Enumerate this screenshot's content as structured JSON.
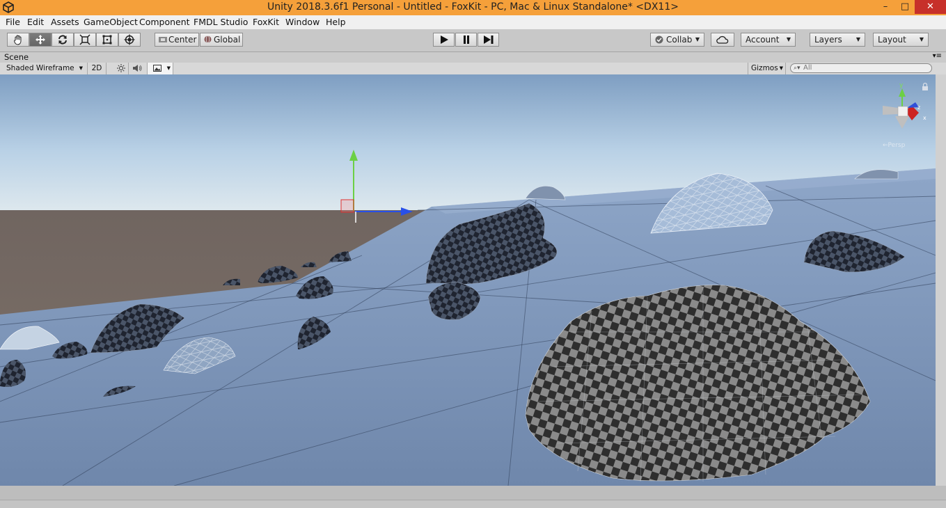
{
  "window": {
    "title": "Unity 2018.3.6f1 Personal - Untitled - FoxKit - PC, Mac & Linux Standalone* <DX11>",
    "minimize": "–",
    "maximize": "□",
    "close": "✕",
    "accent_color": "#f5a03a"
  },
  "menu": [
    "File",
    "Edit",
    "Assets",
    "GameObject",
    "Component",
    "FMDL Studio",
    "FoxKit",
    "Window",
    "Help"
  ],
  "toolbar": {
    "tools": [
      "hand-icon",
      "move-icon",
      "rotate-icon",
      "scale-icon",
      "rect-icon",
      "transform-icon"
    ],
    "pivot_mode": "Center",
    "pivot_rotation": "Global",
    "play": "play-icon",
    "pause": "pause-icon",
    "step": "step-icon",
    "collab": "Collab",
    "account": "Account",
    "layers": "Layers",
    "layout": "Layout"
  },
  "scene": {
    "tab_label": "Scene",
    "draw_mode": "Shaded Wireframe",
    "mode_2d": "2D",
    "gizmos": "Gizmos",
    "search_placeholder": "All",
    "gizmo_label_y": "y",
    "gizmo_label_z": "z",
    "gizmo_label_x": "x",
    "gizmo_persp": "←Persp"
  }
}
